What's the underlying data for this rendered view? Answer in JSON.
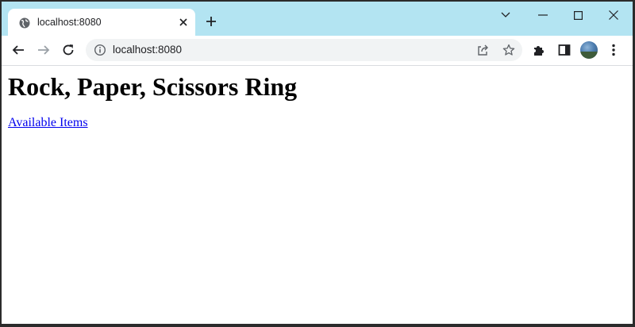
{
  "browser": {
    "tab": {
      "title": "localhost:8080"
    },
    "address_bar": {
      "url": "localhost:8080"
    }
  },
  "page": {
    "heading": "Rock, Paper, Scissors Ring",
    "link_text": "Available Items"
  },
  "colors": {
    "tabstrip_bg": "#b3e4f2",
    "link": "#0000ee",
    "omnibox_bg": "#f1f3f4"
  }
}
